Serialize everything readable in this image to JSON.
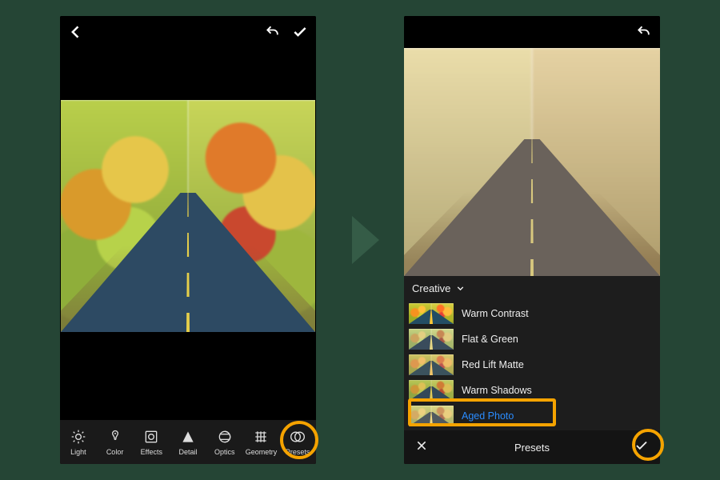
{
  "screen_left": {
    "toolbar": [
      {
        "id": "light",
        "label": "Light"
      },
      {
        "id": "color",
        "label": "Color"
      },
      {
        "id": "effects",
        "label": "Effects"
      },
      {
        "id": "detail",
        "label": "Detail"
      },
      {
        "id": "optics",
        "label": "Optics"
      },
      {
        "id": "geometry",
        "label": "Geometry"
      },
      {
        "id": "presets",
        "label": "Presets"
      }
    ]
  },
  "screen_right": {
    "category_label": "Creative",
    "presets": [
      {
        "id": "warm-contrast",
        "label": "Warm Contrast"
      },
      {
        "id": "flat-green",
        "label": "Flat & Green"
      },
      {
        "id": "red-lift-matte",
        "label": "Red Lift Matte"
      },
      {
        "id": "warm-shadows",
        "label": "Warm Shadows"
      },
      {
        "id": "aged-photo",
        "label": "Aged Photo",
        "selected": true
      }
    ],
    "bottom_title": "Presets"
  }
}
